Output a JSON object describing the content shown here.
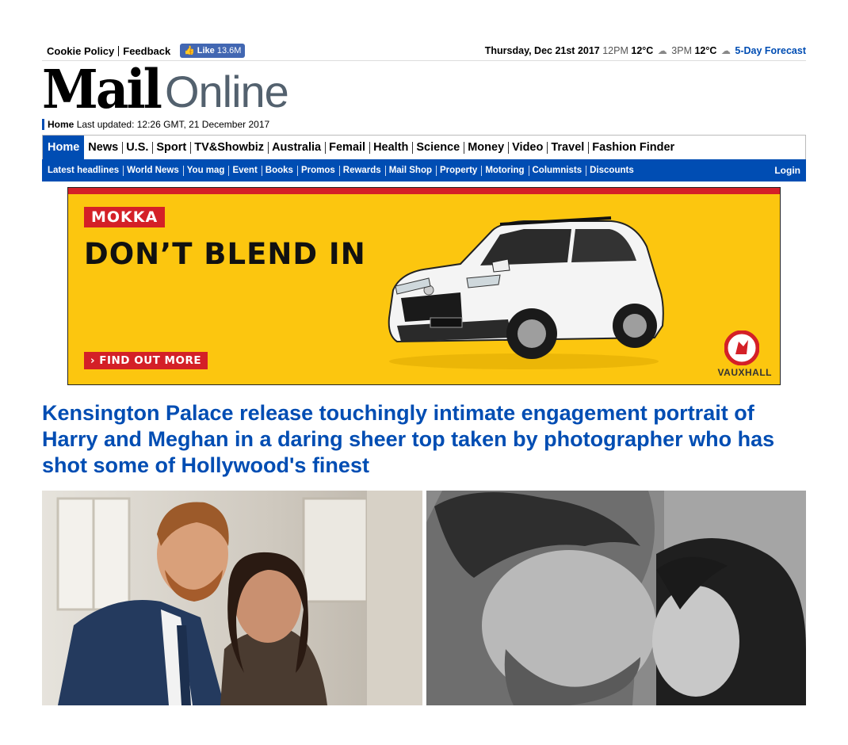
{
  "topbar": {
    "cookie_policy": "Cookie Policy",
    "feedback": "Feedback",
    "like_label": "Like",
    "like_count": "13.6M",
    "date": "Thursday, Dec 21st 2017",
    "t1_time": "12PM",
    "t1_temp": "12°C",
    "t2_time": "3PM",
    "t2_temp": "12°C",
    "forecast_link": "5-Day Forecast"
  },
  "masthead": {
    "mail": "Mail",
    "online": "Online"
  },
  "updated": {
    "home": "Home",
    "text": "Last updated: 12:26 GMT, 21 December 2017"
  },
  "nav_primary": [
    "Home",
    "News",
    "U.S.",
    "Sport",
    "TV&Showbiz",
    "Australia",
    "Femail",
    "Health",
    "Science",
    "Money",
    "Video",
    "Travel",
    "Fashion Finder"
  ],
  "nav_secondary": [
    "Latest headlines",
    "World News",
    "You mag",
    "Event",
    "Books",
    "Promos",
    "Rewards",
    "Mail Shop",
    "Property",
    "Motoring",
    "Columnists",
    "Discounts"
  ],
  "login": "Login",
  "ad": {
    "model": "MOKKA",
    "slogan": "DON’T BLEND IN",
    "cta": "› FIND OUT MORE",
    "brand": "VAUXHALL",
    "plate": "Mokka",
    "colors": {
      "background": "#fcc60f",
      "accent": "#d42027"
    }
  },
  "article": {
    "headline": "Kensington Palace release touchingly intimate engagement portrait of Harry and Meghan in a daring sheer top taken by photographer who has shot some of Hollywood's finest"
  },
  "colors": {
    "brand_blue": "#004db3"
  }
}
